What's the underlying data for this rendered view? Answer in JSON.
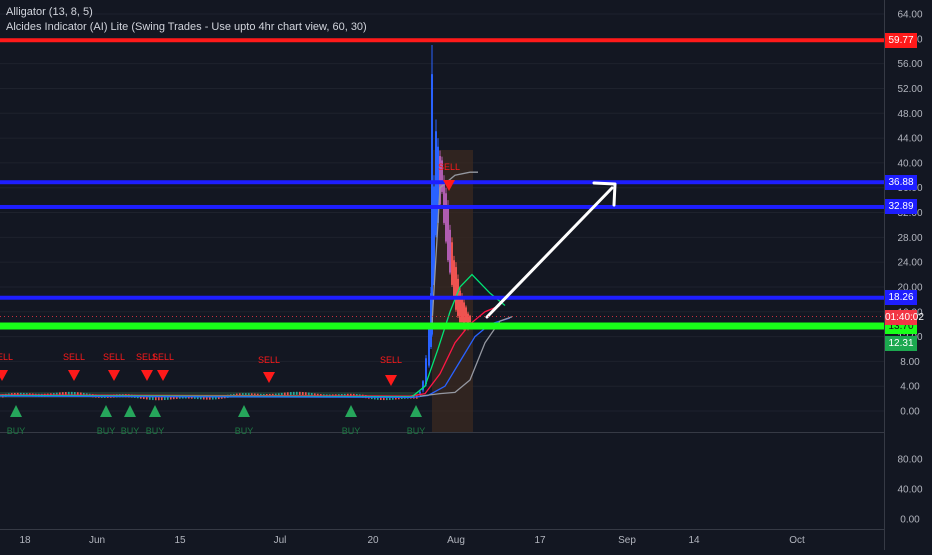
{
  "legend": {
    "line1": "Alligator (13, 8, 5)",
    "line2": "Alcides Indicator (AI) Lite (Swing Trades - Use upto 4hr chart view, 60, 30)"
  },
  "colors": {
    "background": "#131722",
    "red_level": "#ff1a1a",
    "blue_level": "#1e1eff",
    "green_level": "#19ff19",
    "sell_arrow": "#ff1a1a",
    "buy_arrow": "#26a65b",
    "arrow": "#ffffff",
    "jaw": "#2962ff",
    "teeth": "#ff1744",
    "lips": "#00e676"
  },
  "price_axis": {
    "ticks": [
      "64.00",
      "60.00",
      "56.00",
      "52.00",
      "48.00",
      "44.00",
      "40.00",
      "36.00",
      "32.00",
      "28.00",
      "24.00",
      "20.00",
      "16.00",
      "12.00",
      "8.00",
      "4.00",
      "0.00"
    ]
  },
  "osc_axis": {
    "ticks": [
      "80.00",
      "40.00",
      "0.00"
    ]
  },
  "time_axis": {
    "labels": [
      "18",
      "Jun",
      "15",
      "Jul",
      "20",
      "Aug",
      "17",
      "Sep",
      "14",
      "Oct"
    ]
  },
  "levels": [
    {
      "price": 59.77,
      "label": "59.77",
      "color": "red"
    },
    {
      "price": 36.88,
      "label": "36.88",
      "color": "blue"
    },
    {
      "price": 32.89,
      "label": "32.89",
      "color": "blue"
    },
    {
      "price": 18.26,
      "label": "18.26",
      "color": "blue"
    },
    {
      "price": 13.7,
      "label": "13.70",
      "color": "green"
    }
  ],
  "price_badges": [
    {
      "label": "01:40:02",
      "price": 15.0,
      "color": "#f23645"
    },
    {
      "label": "12.31",
      "price": 10.9,
      "color": "#1ca84f"
    }
  ],
  "signals": {
    "sell": [
      {
        "label": "SELL"
      },
      {
        "label": "SELL"
      },
      {
        "label": "SELL"
      },
      {
        "label": "SELL"
      },
      {
        "label": "SELL"
      },
      {
        "label": "SELL"
      },
      {
        "label": "SELL"
      },
      {
        "label": "SELL"
      }
    ],
    "buy": [
      {
        "label": "BUY"
      },
      {
        "label": "BUY"
      },
      {
        "label": "BUY"
      },
      {
        "label": "BUY"
      },
      {
        "label": "BUY"
      },
      {
        "label": "BUY"
      },
      {
        "label": "BUY"
      }
    ]
  },
  "chart_data": {
    "type": "candlestick",
    "symbol_price_range": [
      0,
      64
    ],
    "notes": "Flat price near 2–3 until late July, then spike to ~59 in early August, pulling back to ~15",
    "approx_closes": [
      2.5,
      2.6,
      2.4,
      2.8,
      2.7,
      2.6,
      2.5,
      2.4,
      2.3,
      2.3,
      2.4,
      2.5,
      2.6,
      2.8,
      3.5,
      6,
      12,
      25,
      38,
      30,
      24,
      19,
      16,
      15
    ],
    "oscillator_range": [
      0,
      100
    ]
  }
}
